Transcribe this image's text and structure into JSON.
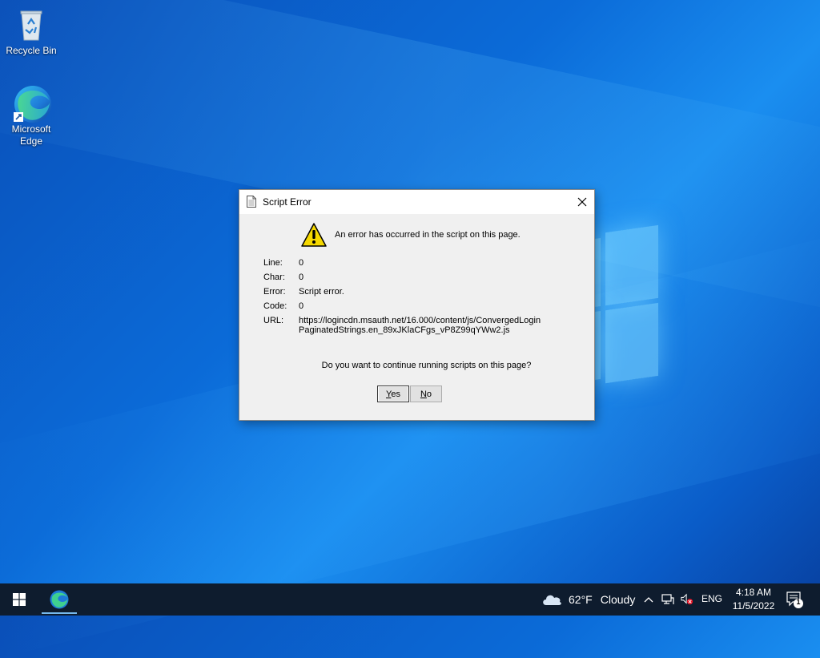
{
  "desktop": {
    "icons": [
      {
        "label": "Recycle Bin",
        "icon": "recycle-bin-icon"
      },
      {
        "label": "Microsoft Edge",
        "icon": "edge-icon"
      }
    ]
  },
  "dialog": {
    "title": "Script Error",
    "message": "An error has occurred in the script on this page.",
    "details": [
      {
        "label": "Line:",
        "value": "0"
      },
      {
        "label": "Char:",
        "value": "0"
      },
      {
        "label": "Error:",
        "value": "Script error."
      },
      {
        "label": "Code:",
        "value": "0"
      },
      {
        "label": "URL:",
        "value": "https://logincdn.msauth.net/16.000/content/js/ConvergedLoginPaginatedStrings.en_89xJKlaCFgs_vP8Z99qYWw2.js"
      }
    ],
    "question": "Do you want to continue running scripts on this page?",
    "yes_label_prefix": "Y",
    "yes_label_rest": "es",
    "no_label_prefix": "N",
    "no_label_rest": "o"
  },
  "taskbar": {
    "weather_temp": "62°F",
    "weather_desc": "Cloudy",
    "language": "ENG",
    "time": "4:18 AM",
    "date": "11/5/2022",
    "notification_count": "1"
  },
  "colors": {
    "taskbar_bg": "#0e1c2e",
    "dialog_bg": "#f0f0f0",
    "warning_yellow": "#f5d800"
  }
}
